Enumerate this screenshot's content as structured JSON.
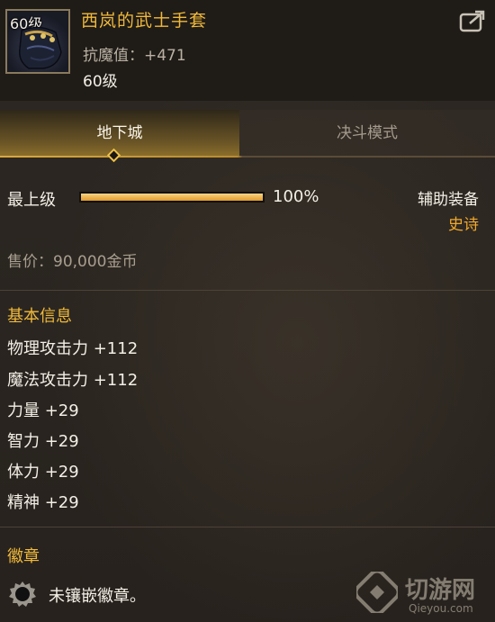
{
  "item": {
    "level_badge": "60级",
    "name": "西岚的武士手套",
    "stat_line": "抗魔值：+471",
    "level": "60级",
    "icon": "gauntlet-icon"
  },
  "header": {
    "share_icon": "share-icon"
  },
  "tabs": [
    {
      "label": "地下城",
      "active": true
    },
    {
      "label": "决斗模式",
      "active": false
    }
  ],
  "upgrade": {
    "label": "最上级",
    "progress_percent": 100,
    "percent_text": "100%"
  },
  "equipment": {
    "type": "辅助装备",
    "rarity": "史诗"
  },
  "price": "售价：90,000金币",
  "basic_info": {
    "title": "基本信息",
    "attributes": [
      "物理攻击力 +112",
      "魔法攻击力 +112",
      "力量 +29",
      "智力 +29",
      "体力 +29",
      "精神 +29"
    ]
  },
  "emblem": {
    "title": "徽章",
    "status": "未镶嵌徽章。",
    "icon": "empty-socket-icon"
  },
  "watermark": {
    "name": "切游网",
    "domain": "Qieyou.com"
  },
  "colors": {
    "accent_gold": "#f0b93a",
    "rarity_epic": "#f0a92c",
    "text_main": "#f3efe6",
    "text_muted": "#a89f90"
  }
}
